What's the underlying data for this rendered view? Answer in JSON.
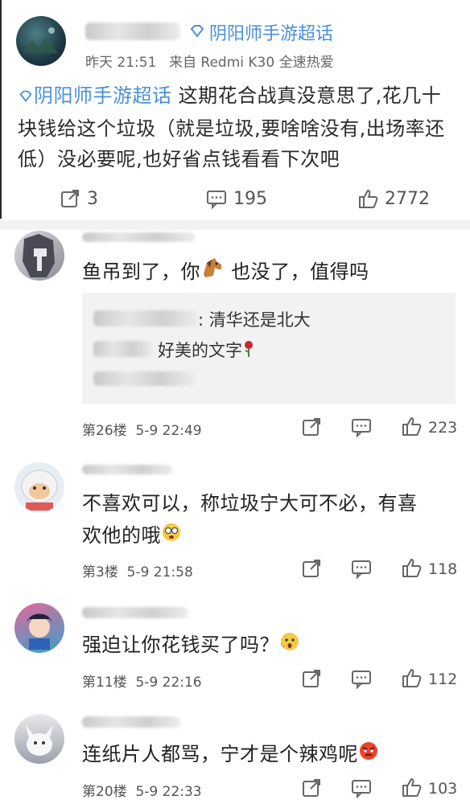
{
  "post": {
    "topic_tag": "阴阳师手游超话",
    "time": "昨天 21:51",
    "source": "来自 Redmi K30 全速热爱",
    "topic_inline": "阴阳师手游超话",
    "text": " 这期花合战真没意思了,花几十块钱给这个垃圾（就是垃圾,要啥啥没有,出场率还低）没必要呢,也好省点钱看看下次吧",
    "share_count": "3",
    "comment_count": "195",
    "like_count": "2772"
  },
  "comments": [
    {
      "text_before": "鱼吊到了，你",
      "text_after": " 也没了，值得吗",
      "quote_line1": "清华还是北大",
      "quote_line2": "好美的文字",
      "floor": "第26楼",
      "time": "5-9 22:49",
      "likes": "223"
    },
    {
      "text": "不喜欢可以，称垃圾宁大可不必，有喜欢他的哦",
      "floor": "第3楼",
      "time": "5-9 21:58",
      "likes": "118"
    },
    {
      "text": "强迫让你花钱买了吗？",
      "floor": "第11楼",
      "time": "5-9 22:16",
      "likes": "112"
    },
    {
      "text": "连纸片人都骂，宁才是个辣鸡呢",
      "floor": "第20楼",
      "time": "5-9 22:33",
      "likes": "103"
    }
  ]
}
